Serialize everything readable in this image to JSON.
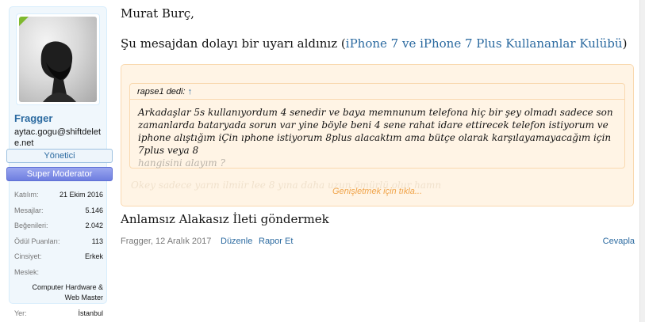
{
  "user": {
    "username": "Fragger",
    "title": "aytac.gogu@shiftdelete.net",
    "badges": {
      "admin": "Yönetici",
      "moderator": "Super Moderator"
    },
    "stats": [
      {
        "key": "Katılım:",
        "value": "21 Ekim 2016"
      },
      {
        "key": "Mesajlar:",
        "value": "5.146"
      },
      {
        "key": "Beğenileri:",
        "value": "2.042"
      },
      {
        "key": "Ödül Puanları:",
        "value": "113"
      },
      {
        "key": "Cinsiyet:",
        "value": "Erkek"
      }
    ],
    "occupation": {
      "key": "Meslek:",
      "value_line1": "Computer Hardware &",
      "value_line2": "Web Master"
    },
    "location": {
      "key": "Yer:",
      "value": "İstanbul"
    }
  },
  "message": {
    "greeting": "Murat Burç,",
    "line2_prefix": "Şu mesajdan dolayı bir uyarı aldınız (",
    "line2_link": "iPhone 7 ve iPhone 7 Plus Kullananlar Kulübü",
    "line2_suffix": ")",
    "quote": {
      "author": "rapse1 dedi:",
      "arrow": "↑",
      "text": "Arkadaşlar 5s kullanıyordum 4 senedir ve baya memnunum telefona hiç bir şey olmadı sadece son zamanlarda bataryada sorun var yine böyle beni 4 sene rahat idare ettirecek telefon istiyorum ve iphone alıştığım iÇin ıphone istiyorum 8plus alacaktım ama bütçe olarak karşılayamayacağım için 7plus veya 8",
      "text_faded": "hangisini alayım ?",
      "fade_line": "Okey sadece yarın ilmiir lee 8 yına daha uzun ömürlü olur hamn",
      "expand": "Genişletmek için tıkla..."
    },
    "signature": "Anlamsız Alakasız İleti göndermek",
    "meta": {
      "author_date": "Fragger, 12 Aralık 2017",
      "edit": "Düzenle",
      "report": "Rapor Et",
      "reply": "Cevapla"
    }
  }
}
